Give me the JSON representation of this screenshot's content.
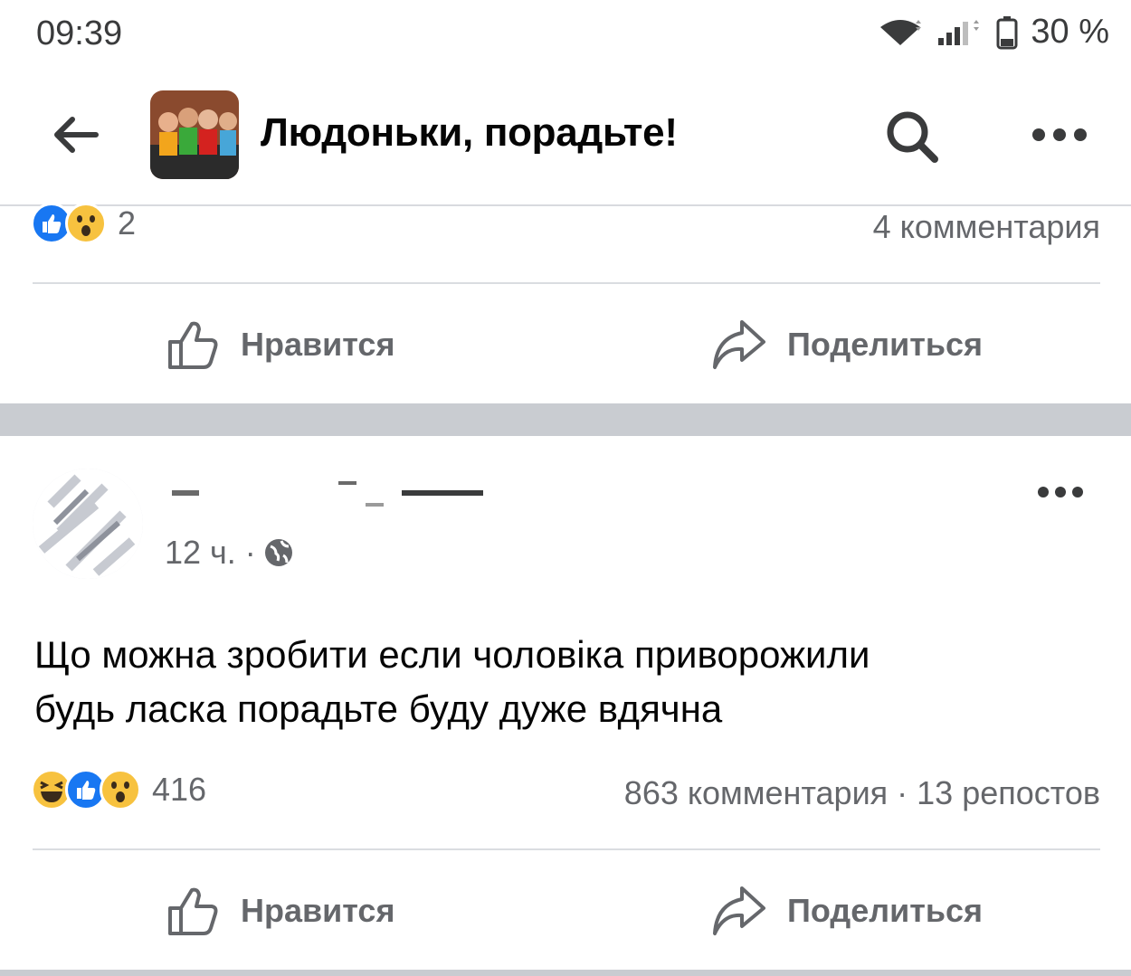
{
  "status": {
    "time": "09:39",
    "battery": "30 %"
  },
  "header": {
    "title": "Людоньки, порадьте!"
  },
  "prev_post": {
    "reaction_count": "2",
    "comments": "4 комментария",
    "like_label": "Нравится",
    "share_label": "Поделиться"
  },
  "post": {
    "time": "12 ч. ·",
    "text_line1": "Що можна зробити если чоловіка приворожили",
    "text_line2": "будь ласка порадьте буду дуже вдячна",
    "reaction_count": "416",
    "comments_shares": "863 комментария · 13 репостов",
    "like_label": "Нравится",
    "share_label": "Поделиться"
  },
  "colors": {
    "like_blue": "#1877f2",
    "emoji_yellow": "#f7c23f",
    "gray_text": "#65676b"
  }
}
